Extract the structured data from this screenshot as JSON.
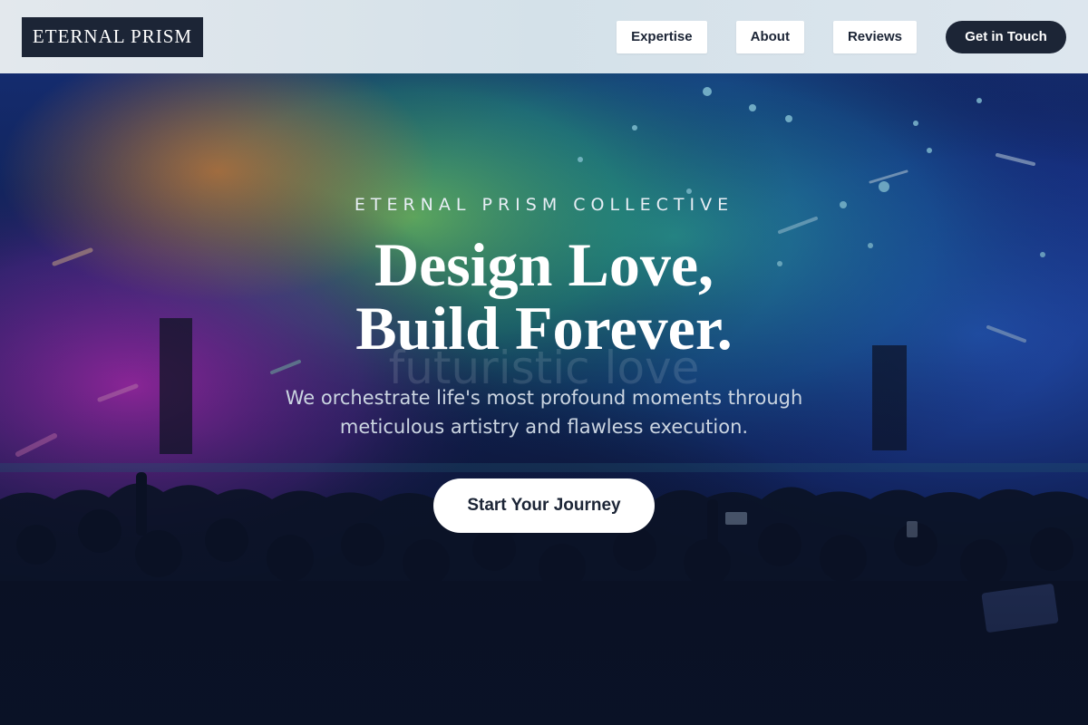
{
  "header": {
    "logo": "ETERNAL PRISM",
    "nav": [
      "Expertise",
      "About",
      "Reviews"
    ],
    "cta": "Get in Touch"
  },
  "hero": {
    "eyebrow": "ETERNAL PRISM COLLECTIVE",
    "title_line1": "Design Love,",
    "title_line2": "Build Forever.",
    "ghost_text": "futuristic love",
    "subtitle": "We orchestrate life's most profound moments through meticulous artistry and flawless execution.",
    "button": "Start Your Journey"
  },
  "colors": {
    "dark_navy": "#1c2536",
    "header_bg": "#dce5ec",
    "white": "#ffffff"
  },
  "icons": []
}
